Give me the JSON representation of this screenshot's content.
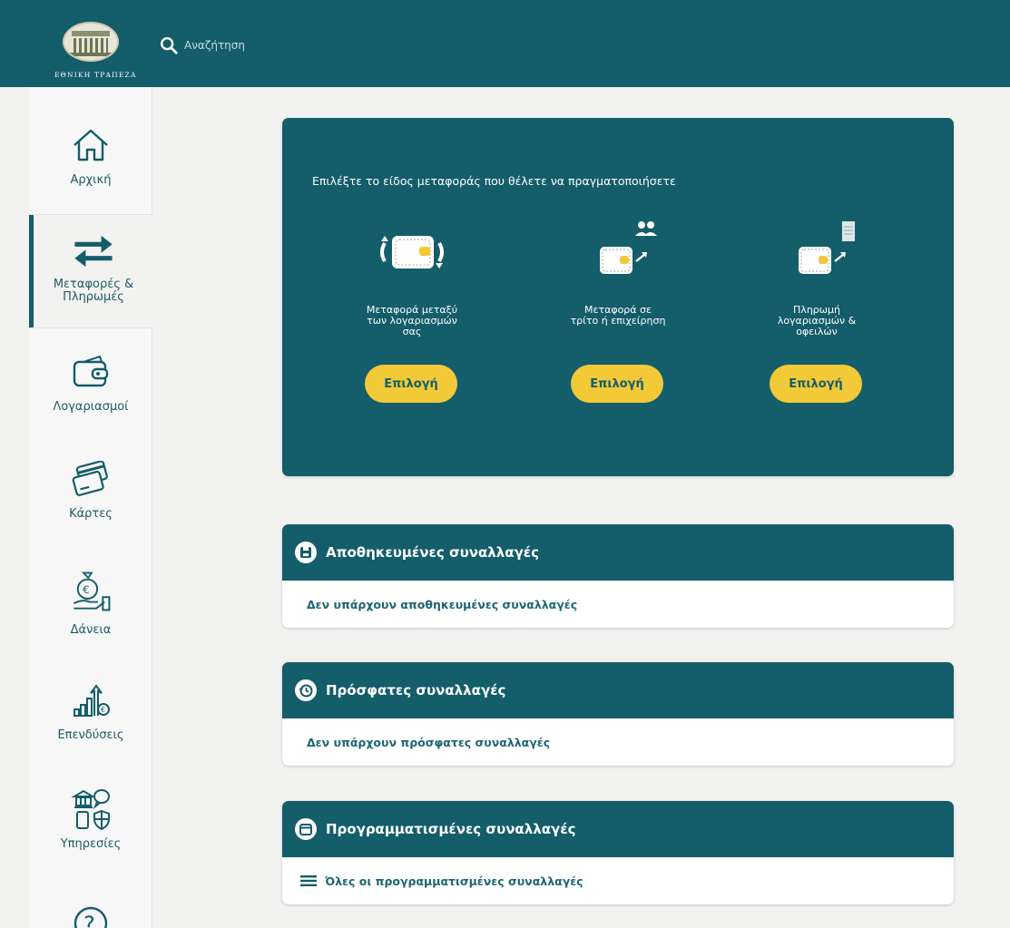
{
  "header": {
    "logo_text": "ΕΘΝΙΚΗ ΤΡΑΠΕΖΑ",
    "search_placeholder": "Αναζήτηση"
  },
  "sidebar": {
    "items": [
      {
        "label": "Αρχική",
        "icon": "home-icon"
      },
      {
        "label": "Μεταφορές &\nΠληρωμές",
        "icon": "transfer-arrows-icon",
        "active": true
      },
      {
        "label": "Λογαριασμοί",
        "icon": "wallet-icon"
      },
      {
        "label": "Κάρτες",
        "icon": "cards-icon"
      },
      {
        "label": "Δάνεια",
        "icon": "loan-icon"
      },
      {
        "label": "Επενδύσεις",
        "icon": "investment-icon"
      },
      {
        "label": "Υπηρεσίες",
        "icon": "services-icon"
      },
      {
        "label": "",
        "icon": "help-icon"
      }
    ]
  },
  "transfer": {
    "prompt": "Επιλέξτε το είδος μεταφοράς που θέλετε να πραγματοποιήσετε",
    "options": [
      {
        "label": "Μεταφορά μεταξύ\nτων λογαριασμών\nσας",
        "button": "Επιλογή",
        "icon": "own-accounts-transfer-icon"
      },
      {
        "label": "Μεταφορά σε\nτρίτο ή επιχείρηση",
        "button": "Επιλογή",
        "icon": "third-party-transfer-icon"
      },
      {
        "label": "Πληρωμή\nλογαριασμών &\nοφειλών",
        "button": "Επιλογή",
        "icon": "bill-payment-icon"
      }
    ]
  },
  "saved": {
    "title": "Αποθηκευμένες συναλλαγές",
    "message": "Δεν υπάρχουν αποθηκευμένες συναλλαγές"
  },
  "recent": {
    "title": "Πρόσφατες συναλλαγές",
    "message": "Δεν υπάρχουν πρόσφατες συναλλαγές"
  },
  "scheduled": {
    "title": "Προγραμματισμένες συναλλαγές",
    "link": "Όλες οι προγραμματισμένες συναλλαγές"
  },
  "colors": {
    "primary": "#145d6a",
    "accent": "#f2c937",
    "background": "#f2f2f0"
  }
}
